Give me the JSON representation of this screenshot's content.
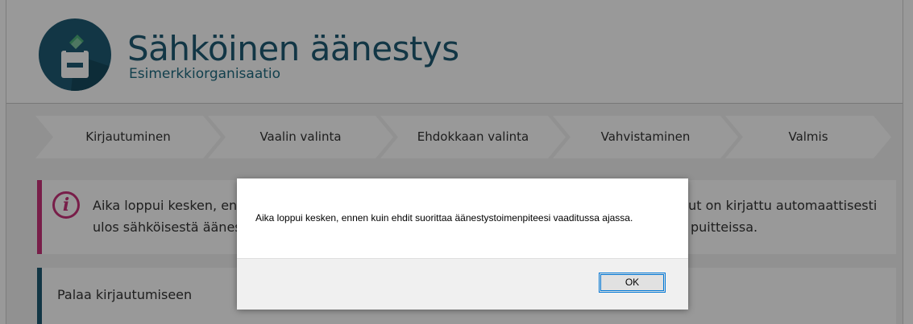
{
  "header": {
    "title": "Sähköinen äänestys",
    "organization": "Esimerkkiorganisaatio",
    "logo_icon": "ballot-box-icon"
  },
  "steps": [
    {
      "label": "Kirjautuminen"
    },
    {
      "label": "Vaalin valinta"
    },
    {
      "label": "Ehdokkaan valinta"
    },
    {
      "label": "Vahvistaminen"
    },
    {
      "label": "Valmis"
    }
  ],
  "alert": {
    "icon": "info-icon",
    "line1": "Aika loppui kesken, ennen kuin ehdit suorittaa äänestystoimenpiteesi vaaditussa ajassa. Sinut on kirjattu automaattisesti",
    "line2": "ulos sähköisestä äänestyksestä. Voit aloittaa äänestyksen alusta uudelleen äänestysaikojen puitteissa."
  },
  "back_link": "Palaa kirjautumiseen",
  "dialog": {
    "message": "Aika loppui kesken, ennen kuin ehdit suorittaa äänestystoimenpiteesi vaaditussa ajassa.",
    "ok_label": "OK"
  },
  "colors": {
    "brand": "#1e5b73",
    "alert_accent": "#c8337a",
    "focus": "#0078d7"
  }
}
